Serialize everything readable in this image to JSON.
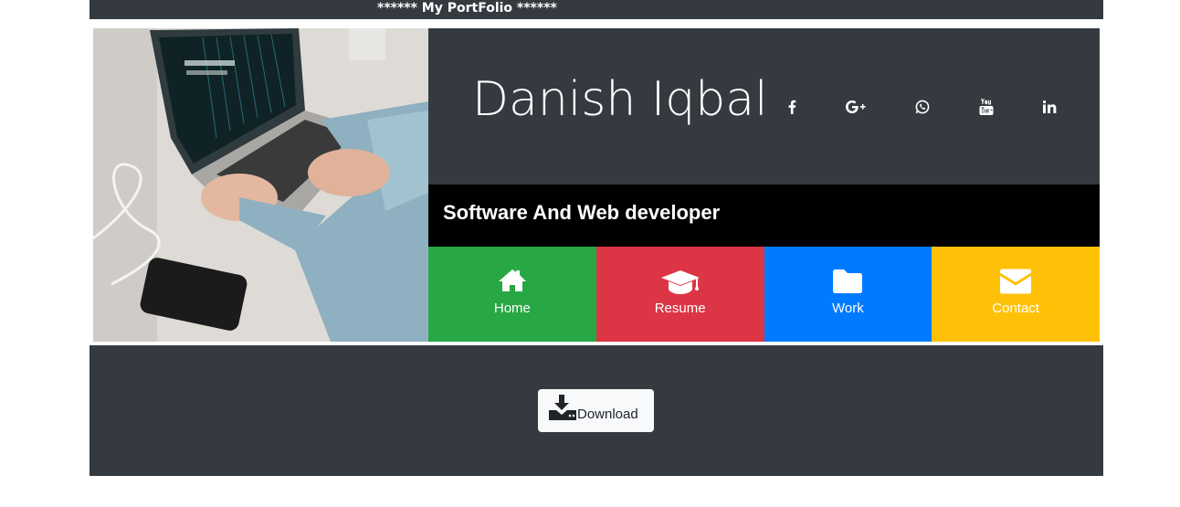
{
  "header": {
    "title": "****** My PortFolio ******"
  },
  "profile": {
    "name": "Danish Iqbal",
    "tagline": "Software And Web developer"
  },
  "social": [
    {
      "icon": "facebook-icon"
    },
    {
      "icon": "google-plus-icon"
    },
    {
      "icon": "whatsapp-icon"
    },
    {
      "icon": "youtube-icon"
    },
    {
      "icon": "linkedin-icon"
    }
  ],
  "nav": {
    "items": [
      {
        "label": "Home",
        "icon": "home-icon",
        "color": "#28a745"
      },
      {
        "label": "Resume",
        "icon": "graduation-cap-icon",
        "color": "#dc3545"
      },
      {
        "label": "Work",
        "icon": "folder-icon",
        "color": "#007bff"
      },
      {
        "label": "Contact",
        "icon": "envelope-icon",
        "color": "#ffc107"
      }
    ]
  },
  "footer": {
    "download_label": "Download",
    "download_icon": "download-icon"
  },
  "colors": {
    "dark": "#343a40",
    "black": "#000000",
    "light": "#f8f9fa"
  }
}
